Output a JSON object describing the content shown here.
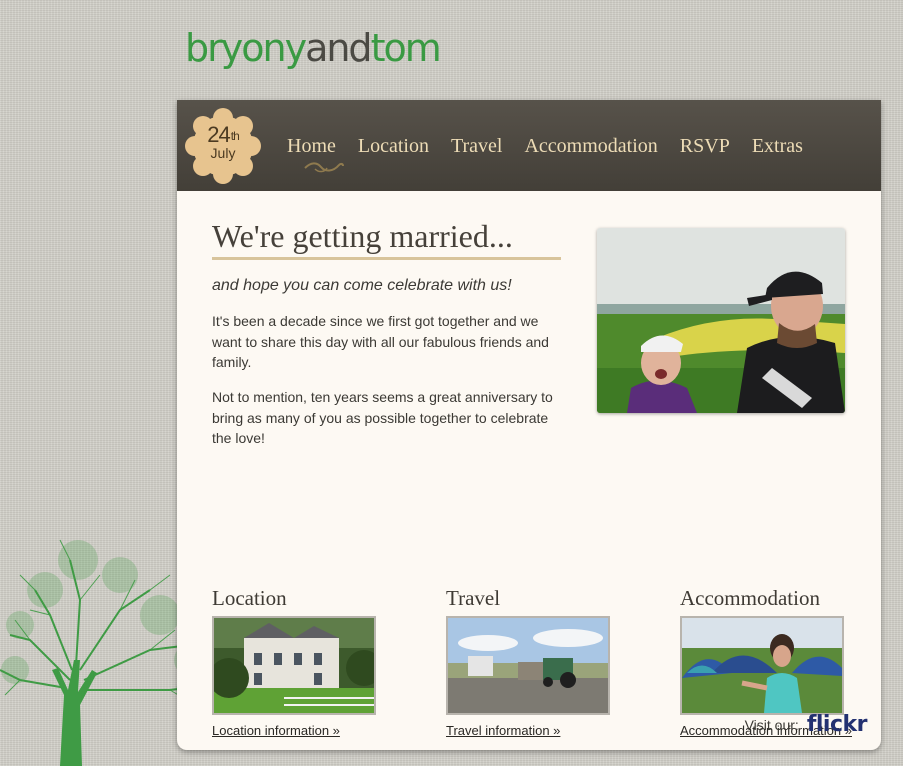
{
  "logo": {
    "part1": "bryony",
    "part2": "and",
    "part3": "tom"
  },
  "badge": {
    "day": "24",
    "suffix": "th",
    "month": "July"
  },
  "nav": {
    "items": [
      "Home",
      "Location",
      "Travel",
      "Accommodation",
      "RSVP",
      "Extras"
    ],
    "active": "Home"
  },
  "main": {
    "headline": "We're getting married...",
    "tagline": "and hope you can come celebrate with us!",
    "paragraph1": "It's been a decade since we first got together and we want to share this day with all our fabulous friends and family.",
    "paragraph2": "Not to mention, ten years seems a great anniversary to bring as many of you as possible together to celebrate the love!"
  },
  "sections": [
    {
      "title": "Location",
      "link": "Location information »"
    },
    {
      "title": "Travel",
      "link": "Travel information »"
    },
    {
      "title": "Accommodation",
      "link": "Accommodation information »"
    }
  ],
  "footer": {
    "visit": "Visit our:",
    "flickr": "flickr"
  },
  "colors": {
    "brand_green": "#3a9a43",
    "nav_bg": "#4a463f",
    "nav_text": "#eddcb6",
    "card_bg": "#fdf9f3",
    "badge": "#e7c48f"
  }
}
